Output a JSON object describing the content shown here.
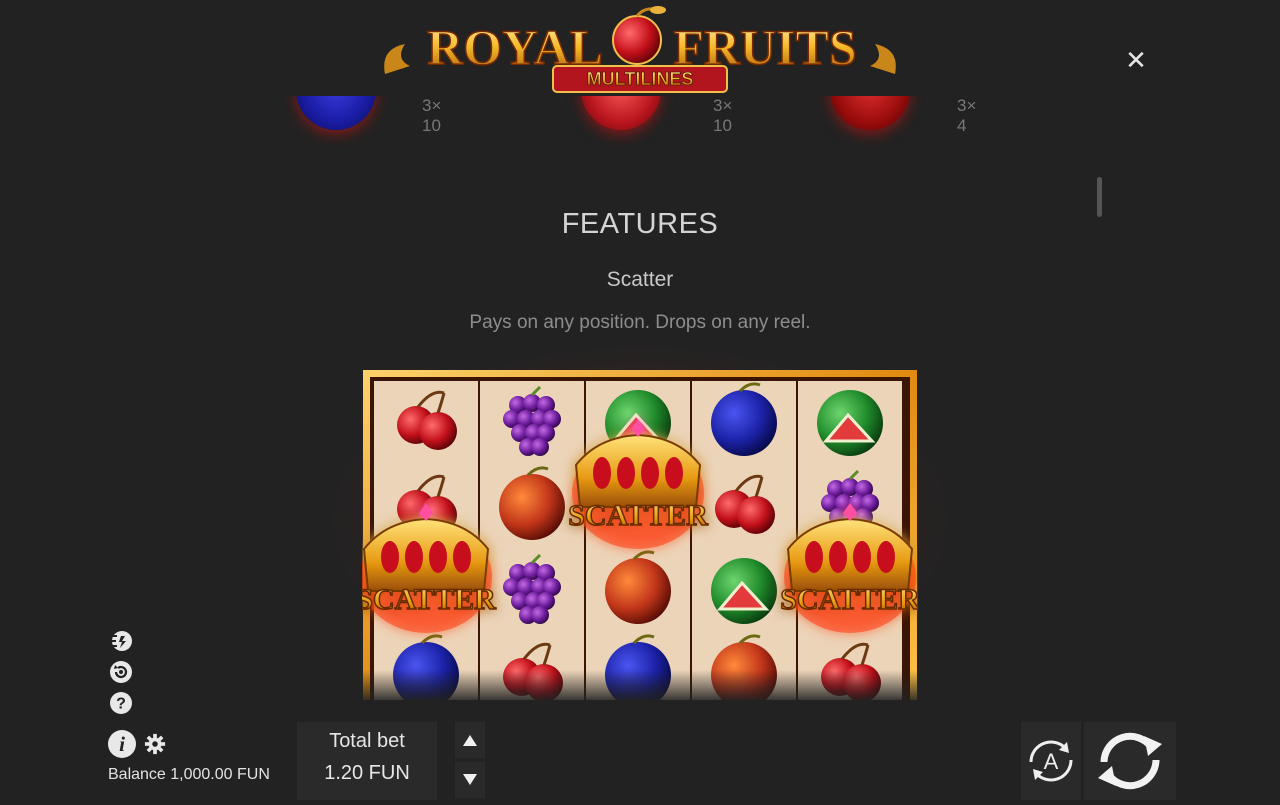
{
  "logo": {
    "title_left": "ROYAL",
    "title_right": "FRUITS",
    "ribbon": "MULTILINES"
  },
  "close_icon": "close-icon",
  "paytable": [
    {
      "fruit": "plum",
      "color": "#1b1ea8",
      "multiplier": "3× 10"
    },
    {
      "fruit": "orange",
      "color": "#b8151e",
      "multiplier": "3× 10"
    },
    {
      "fruit": "cherry",
      "color": "#9a0c0c",
      "multiplier": "3× 4"
    }
  ],
  "features": {
    "title": "FEATURES",
    "subtitle": "Scatter",
    "description": "Pays on any position. Drops on any reel."
  },
  "reels": {
    "columns": [
      [
        "cherry",
        "cherry",
        "scatter",
        "plum"
      ],
      [
        "grapes",
        "orange",
        "grapes",
        "cherry"
      ],
      [
        "watermelon",
        "scatter",
        "orange",
        "plum"
      ],
      [
        "plum",
        "cherry",
        "watermelon",
        "orange"
      ],
      [
        "watermelon",
        "grapes",
        "scatter",
        "cherry"
      ]
    ],
    "scatter_label": "SCATTER"
  },
  "sidebar_icons": [
    "turbo-icon",
    "autoplay-history-icon",
    "help-icon",
    "info-icon",
    "settings-icon"
  ],
  "balance": "Balance 1,000.00 FUN",
  "bet": {
    "label": "Total bet",
    "value": "1.20 FUN"
  },
  "controls": {
    "auto_label": "A"
  },
  "colors": {
    "background": "#222222",
    "panel": "#2a2a2a",
    "gold": "#e8a317",
    "reel_bg": "#ecd4b8"
  }
}
